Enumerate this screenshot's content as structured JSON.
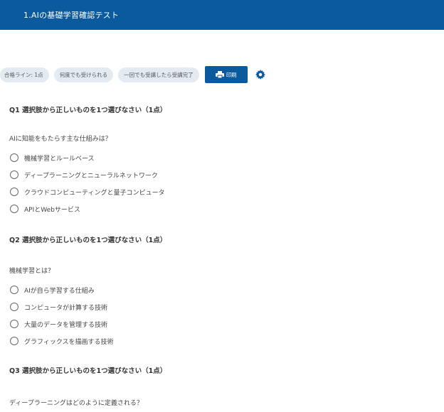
{
  "header": {
    "title": "1.AIの基礎学習確認テスト"
  },
  "toolbar": {
    "pills": [
      "合格ライン: 1点",
      "何度でも受けられる",
      "一回でも受講したら受講完了"
    ],
    "print_label": "印刷"
  },
  "questions": [
    {
      "title": "Q1 選択肢から正しいものを1つ選びなさい（1点）",
      "text": "AIに知能をもたらす主な仕組みは？",
      "options": [
        "機械学習とルールベース",
        "ディープラーニングとニューラルネットワーク",
        "クラウドコンピューティングと量子コンピュータ",
        "APIとWebサービス"
      ]
    },
    {
      "title": "Q2 選択肢から正しいものを1つ選びなさい（1点）",
      "text": "機械学習とは？",
      "options": [
        "AIが自ら学習する仕組み",
        "コンピュータが計算する技術",
        "大量のデータを管理する技術",
        "グラフィックスを描画する技術"
      ]
    },
    {
      "title": "Q3 選択肢から正しいものを1つ選びなさい（1点）",
      "text": "ディープラーニングはどのように定義される？",
      "options": []
    }
  ]
}
